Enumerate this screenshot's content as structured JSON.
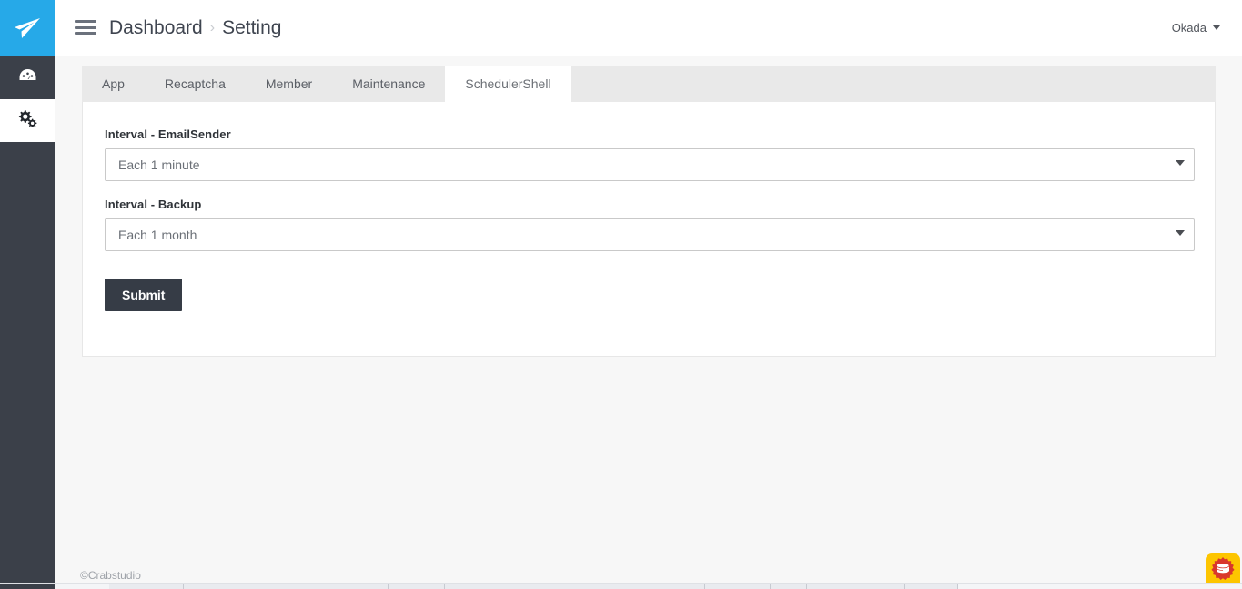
{
  "sidebar": {
    "logo_icon": "paper-plane-icon",
    "items": [
      {
        "icon": "dashboard-speedometer-icon",
        "label": "Dashboard",
        "active": false
      },
      {
        "icon": "gears-settings-icon",
        "label": "Setting",
        "active": true
      }
    ]
  },
  "header": {
    "menu_icon": "hamburger-menu-icon",
    "breadcrumb": {
      "root": "Dashboard",
      "separator": "›",
      "current": "Setting"
    },
    "user": {
      "name": "Okada",
      "caret_icon": "chevron-down-icon"
    }
  },
  "tabs": [
    {
      "label": "App",
      "active": false
    },
    {
      "label": "Recaptcha",
      "active": false
    },
    {
      "label": "Member",
      "active": false
    },
    {
      "label": "Maintenance",
      "active": false
    },
    {
      "label": "SchedulerShell",
      "active": true
    }
  ],
  "form": {
    "fields": [
      {
        "label": "Interval - EmailSender",
        "value": "Each 1 minute",
        "arrow_icon": "caret-down-icon"
      },
      {
        "label": "Interval - Backup",
        "value": "Each 1 month",
        "arrow_icon": "caret-down-icon"
      }
    ],
    "submit_label": "Submit"
  },
  "footer": {
    "copyright": "©Crabstudio"
  },
  "float_widget": {
    "icon": "database-stack-gear-icon",
    "label": ""
  },
  "colors": {
    "brand_blue": "#26a9e8",
    "sidebar_dark": "#3b4049",
    "submit_dark": "#363c46",
    "tabbar_grey": "#e9e9e9",
    "content_bg": "#f7f7f7",
    "widget_yellow": "#fdc500",
    "widget_red": "#d9372b"
  }
}
